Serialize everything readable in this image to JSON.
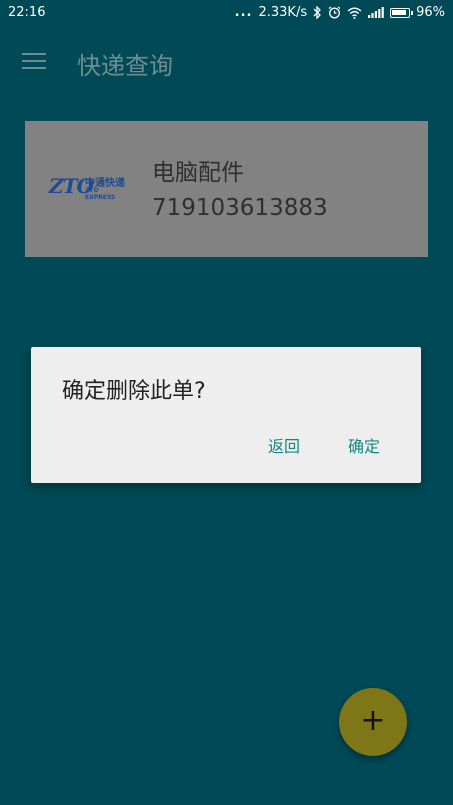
{
  "status_bar": {
    "time": "22:16",
    "dots": "...",
    "network_speed": "2.33K/s",
    "battery_percent": "96%",
    "icons": [
      "bluetooth-icon",
      "alarm-icon",
      "wifi-icon",
      "signal-icon",
      "battery-icon"
    ]
  },
  "toolbar": {
    "title": "快递查询",
    "menu_icon": "menu-icon"
  },
  "package_card": {
    "courier_logo_text": "ZTO",
    "courier_name_cn": "中通快递",
    "courier_name_en": "ZTO EXPRESS",
    "title": "电脑配件",
    "tracking_number": "719103613883"
  },
  "dialog": {
    "message": "确定删除此单?",
    "back_label": "返回",
    "confirm_label": "确定"
  },
  "fab": {
    "label": "+"
  },
  "colors": {
    "background": "#004a57",
    "card": "#828282",
    "dialog": "#eeeeee",
    "accent_text": "#0f8a86",
    "fab": "#7f7618"
  }
}
